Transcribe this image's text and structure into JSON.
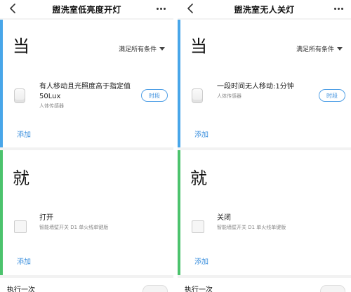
{
  "panels": [
    {
      "title": "盥洗室低亮度开灯",
      "when": {
        "heading": "当",
        "condition_selector": "满足所有条件",
        "item": {
          "main": "有人移动且光照度高于指定值 50Lux",
          "sub": "人体传感器",
          "time_button": "时段"
        },
        "add_label": "添加"
      },
      "then": {
        "heading": "就",
        "item": {
          "main": "打开",
          "sub": "智能墙壁开关 D1 单火线单键版"
        },
        "add_label": "添加"
      },
      "footer_label": "执行一次"
    },
    {
      "title": "盥洗室无人关灯",
      "when": {
        "heading": "当",
        "condition_selector": "满足所有条件",
        "item": {
          "main": "一段时间无人移动:1分钟",
          "sub": "人体传感器",
          "time_button": "时段"
        },
        "add_label": "添加"
      },
      "then": {
        "heading": "就",
        "item": {
          "main": "关闭",
          "sub": "智能墙壁开关 D1 单火线单键版"
        },
        "add_label": "添加"
      },
      "footer_label": "执行一次"
    }
  ],
  "colors": {
    "when_accent": "#48a6e9",
    "then_accent": "#4cc36d",
    "link": "#3b8fdd"
  },
  "icons": {
    "back": "chevron-left-icon",
    "more": "more-dots-icon",
    "sensor": "motion-sensor-icon",
    "switch": "wall-switch-icon",
    "selector": "triangle-down-icon"
  }
}
